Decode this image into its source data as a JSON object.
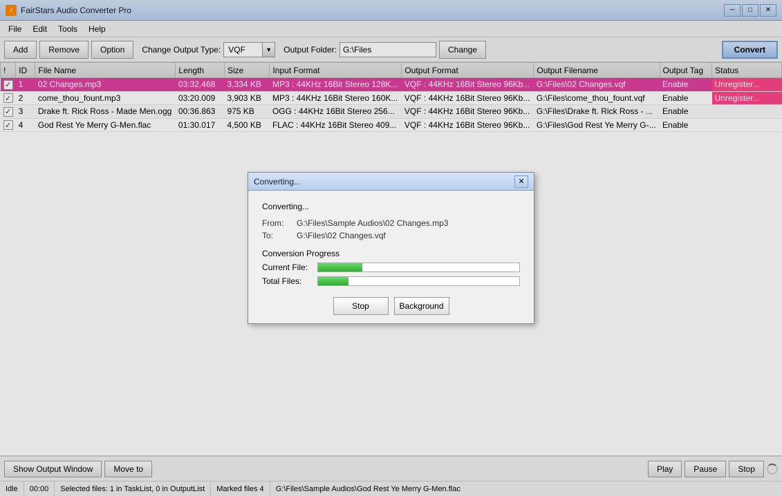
{
  "app": {
    "title": "FairStars Audio Converter Pro",
    "icon": "♪"
  },
  "window_controls": {
    "minimize": "─",
    "maximize": "□",
    "close": "✕"
  },
  "menu": {
    "items": [
      "File",
      "Edit",
      "Tools",
      "Help"
    ]
  },
  "toolbar": {
    "add_label": "Add",
    "remove_label": "Remove",
    "option_label": "Option",
    "output_type_label": "Change Output Type:",
    "output_type_value": "VQF",
    "output_folder_label": "Output Folder:",
    "output_folder_value": "G:\\Files",
    "change_label": "Change",
    "convert_label": "Convert"
  },
  "table": {
    "headers": [
      "!",
      "ID",
      "File Name",
      "Length",
      "Size",
      "Input Format",
      "Output Format",
      "Output Filename",
      "Output Tag",
      "Status"
    ],
    "rows": [
      {
        "checked": true,
        "id": "1",
        "file_name": "02 Changes.mp3",
        "length": "03:32.468",
        "size": "3,334 KB",
        "input_format": "MP3 : 44KHz 16Bit Stereo 128K...",
        "output_format": "VQF : 44KHz 16Bit Stereo 96Kb...",
        "output_filename": "G:\\Files\\02 Changes.vqf",
        "output_tag": "Enable",
        "status": "Unregister...",
        "selected": true
      },
      {
        "checked": true,
        "id": "2",
        "file_name": "come_thou_fount.mp3",
        "length": "03:20.009",
        "size": "3,903 KB",
        "input_format": "MP3 : 44KHz 16Bit Stereo 160K...",
        "output_format": "VQF : 44KHz 16Bit Stereo 96Kb...",
        "output_filename": "G:\\Files\\come_thou_fount.vqf",
        "output_tag": "Enable",
        "status": "Unregister...",
        "selected": false
      },
      {
        "checked": true,
        "id": "3",
        "file_name": "Drake ft. Rick Ross - Made Men.ogg",
        "length": "00:36.863",
        "size": "975 KB",
        "input_format": "OGG : 44KHz 16Bit Stereo 256...",
        "output_format": "VQF : 44KHz 16Bit Stereo 96Kb...",
        "output_filename": "G:\\Files\\Drake ft. Rick Ross - ...",
        "output_tag": "Enable",
        "status": "",
        "selected": false
      },
      {
        "checked": true,
        "id": "4",
        "file_name": "God Rest Ye Merry G-Men.flac",
        "length": "01:30.017",
        "size": "4,500 KB",
        "input_format": "FLAC : 44KHz 16Bit Stereo 409...",
        "output_format": "VQF : 44KHz 16Bit Stereo 96Kb...",
        "output_filename": "G:\\Files\\God Rest Ye Merry G-...",
        "output_tag": "Enable",
        "status": "",
        "selected": false
      }
    ]
  },
  "bottom_bar": {
    "show_output_label": "Show Output Window",
    "move_to_label": "Move to",
    "play_label": "Play",
    "pause_label": "Pause",
    "stop_label": "Stop"
  },
  "status_bar": {
    "idle": "Idle",
    "time": "00:00",
    "selected_files": "Selected files: 1 in TaskList, 0 in OutputList",
    "marked_files": "Marked files 4",
    "path": "G:\\Files\\Sample Audios\\God Rest Ye Merry G-Men.flac"
  },
  "dialog": {
    "title": "Converting...",
    "status_text": "Converting...",
    "from_label": "From:",
    "from_value": "G:\\Files\\Sample Audios\\02 Changes.mp3",
    "to_label": "To:",
    "to_value": "G:\\Files\\02 Changes.vqf",
    "conversion_progress_label": "Conversion Progress",
    "current_file_label": "Current File:",
    "total_files_label": "Total Files:",
    "current_file_progress": 22,
    "total_files_progress": 15,
    "stop_label": "Stop",
    "background_label": "Background",
    "close_icon": "✕"
  }
}
